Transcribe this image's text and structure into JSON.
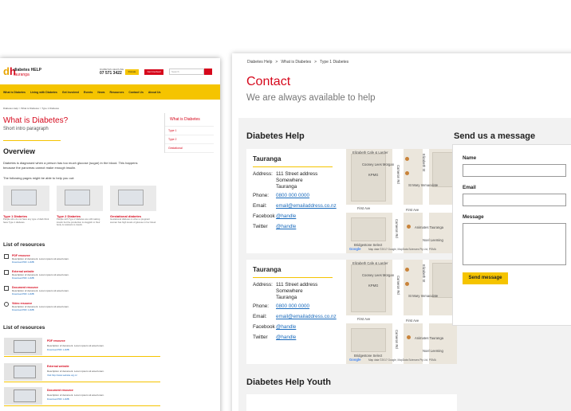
{
  "left": {
    "brand_line1": "diabetes HELP",
    "brand_line2": "tauranga",
    "phone_label": "DIABETES HELPLINE",
    "phone": "07 571 3422",
    "donate": "Donate",
    "get_involved": "Get Involved",
    "search_placeholder": "Search",
    "nav": [
      "What is Diabetes",
      "Living with Diabetes",
      "Get Involved",
      "Events",
      "News",
      "Resources",
      "Contact Us",
      "About Us"
    ],
    "breadcrumb": "Diabetes Help > What is Diabetes > Type 1 Diabetes",
    "title": "What is Diabetes?",
    "subtitle": "Short intro paragraph",
    "sidebar": [
      "What is Diabetes",
      "Type 1",
      "Type 2",
      "Gestational"
    ],
    "overview": "Overview",
    "overview_text": "Diabetes is diagnosed when a person has too much glucose (sugar) in the blood. This happens because the pancreas cannot make enough insulin.",
    "help_text": "The following pages might be able to help you out:",
    "cards": [
      {
        "title": "Type 1 Diabetes",
        "desc": "People who do not have any type of diab think have Type 1 diabetes."
      },
      {
        "title": "Type 2 Diabetes",
        "desc": "People with Type 2 diabetes are still making insulin but the production is sluggish or their body is resistant to insulin."
      },
      {
        "title": "Gestational diabetes",
        "desc": "Gestational diabetes is when a pregnant woman has high levels of glucose in her blood."
      }
    ],
    "resources_title": "List of resources",
    "resources": [
      {
        "title": "PDF resource",
        "desc": "Description of document. Lorem ipsum sit amet lorem.",
        "link": "Download PDF 1.2MB"
      },
      {
        "title": "External website",
        "desc": "Description of document. Lorem ipsum sit amet lorem.",
        "link": "Download PDF 1.2MB"
      },
      {
        "title": "Document resource",
        "desc": "Description of document. Lorem ipsum sit amet lorem.",
        "link": "Download PDF 1.2MB"
      },
      {
        "title": "Video resource",
        "desc": "Description of document. Lorem ipsum sit amet lorem.",
        "link": "Download PDF 1.2MB"
      }
    ],
    "resources2_title": "List of resources",
    "resources2": [
      {
        "title": "PDF resource",
        "desc": "Description of document. Lorem ipsum sit amet lorem.",
        "link": "Download PDF 1.2MB"
      },
      {
        "title": "External website",
        "desc": "Description of document. Lorem ipsum sit amet lorem.",
        "link": "Visit http://www.website.org.nz"
      },
      {
        "title": "Document resource",
        "desc": "Description of document. Lorem ipsum sit amet lorem.",
        "link": "Download PDF 1.2MB"
      }
    ]
  },
  "right": {
    "breadcrumb": [
      "Diabetes Help",
      "What is Diabetes",
      "Type 1 Diabetes"
    ],
    "title": "Contact",
    "subtitle": "We are always available to help",
    "section1": "Diabetes Help",
    "section2": "Diabetes Help Youth",
    "offices": [
      {
        "name": "Tauranga",
        "address_label": "Address:",
        "address": [
          "111 Street address",
          "Somewhere",
          "Tauranga"
        ],
        "phone_label": "Phone:",
        "phone": "0800 000 0000",
        "email_label": "Email:",
        "email": "email@emailaddress.co.nz",
        "facebook_label": "Facebook",
        "facebook": "@handle",
        "twitter_label": "Twitter",
        "twitter": "@handle"
      },
      {
        "name": "Tauranga",
        "address_label": "Address:",
        "address": [
          "111 Street address",
          "Somewhere",
          "Tauranga"
        ],
        "phone_label": "Phone:",
        "phone": "0800 000 0000",
        "email_label": "Email:",
        "email": "email@emailaddress.co.nz",
        "facebook_label": "Facebook",
        "facebook": "@handle",
        "twitter_label": "Twitter",
        "twitter": "@handle"
      }
    ],
    "map_labels": {
      "cafe": "Elizabeth Cafe & Larder",
      "lawyers": "Cooney Lees Morgan",
      "kpmg": "KPMG",
      "immaculate": "St Mary Immaculate",
      "first_ave": "First Ave",
      "elizabeth_st": "Elizabeth St",
      "cameron": "Cameron Rd",
      "animates": "Animates Tauranga",
      "noel": "Noel Leeming",
      "bridgestone": "Bridgestone Select",
      "google": "Google",
      "copyright": "Map data ©2017 Google, MapData Sciences Pty Ltd, PSMA"
    },
    "form": {
      "title": "Send us a message",
      "name": "Name",
      "email": "Email",
      "message": "Message",
      "button": "Send message"
    }
  }
}
